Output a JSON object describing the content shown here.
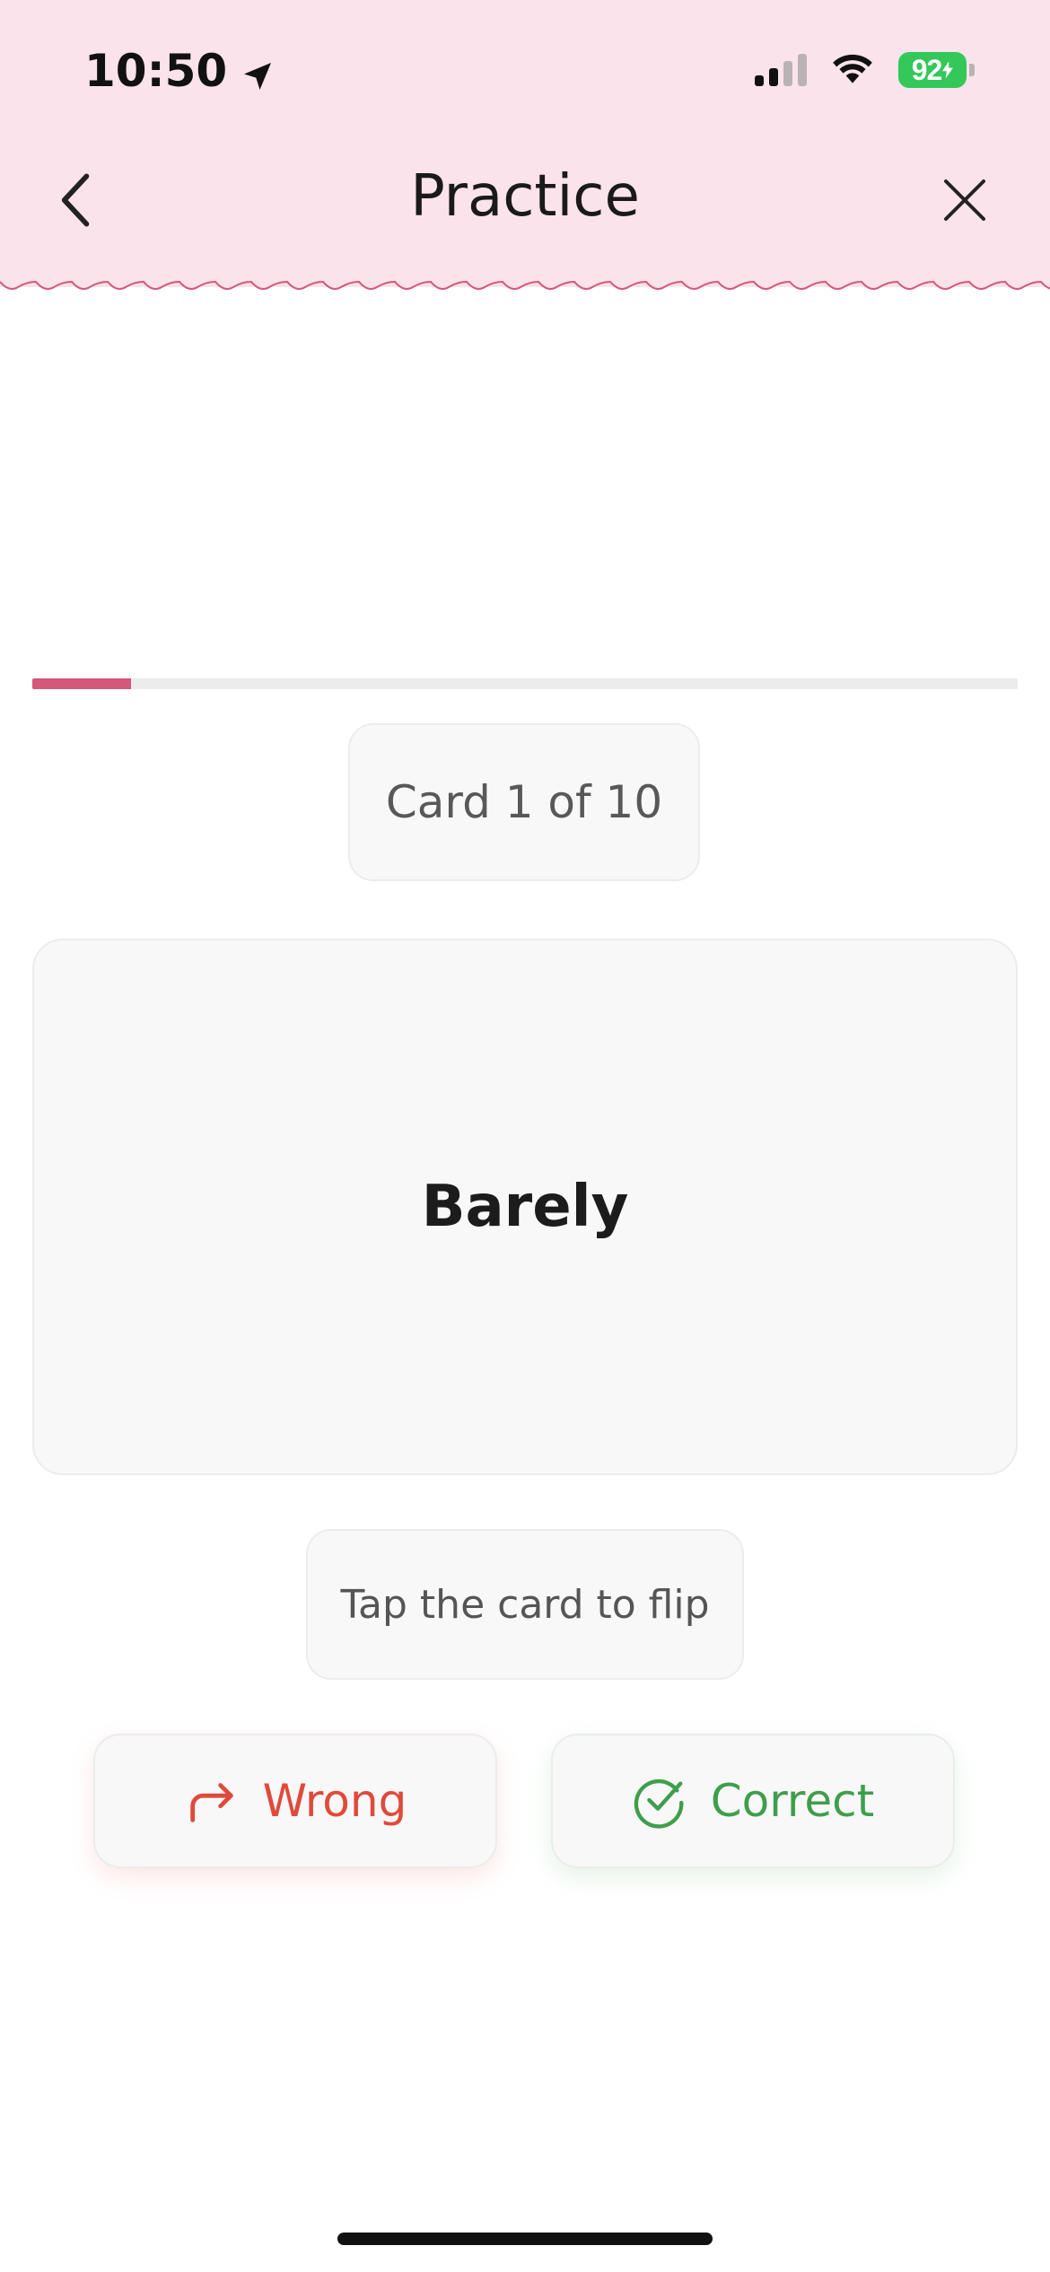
{
  "status_bar": {
    "time": "10:50",
    "battery": "92"
  },
  "nav": {
    "title": "Practice"
  },
  "progress": {
    "current": 1,
    "total": 10,
    "fraction": 0.1
  },
  "counter_text": "Card 1 of 10",
  "card": {
    "front_text": "Barely"
  },
  "hint_text": "Tap the card to flip",
  "buttons": {
    "wrong_label": "Wrong",
    "correct_label": "Correct"
  },
  "colors": {
    "header_bg": "#fae3ea",
    "accent": "#d4587a",
    "wrong": "#e04a3b",
    "correct": "#3f9e4c"
  },
  "icons": {
    "back": "chevron-left-icon",
    "close": "close-icon",
    "wrong": "redo-arrow-icon",
    "correct": "check-circle-icon",
    "location": "location-arrow-icon"
  }
}
